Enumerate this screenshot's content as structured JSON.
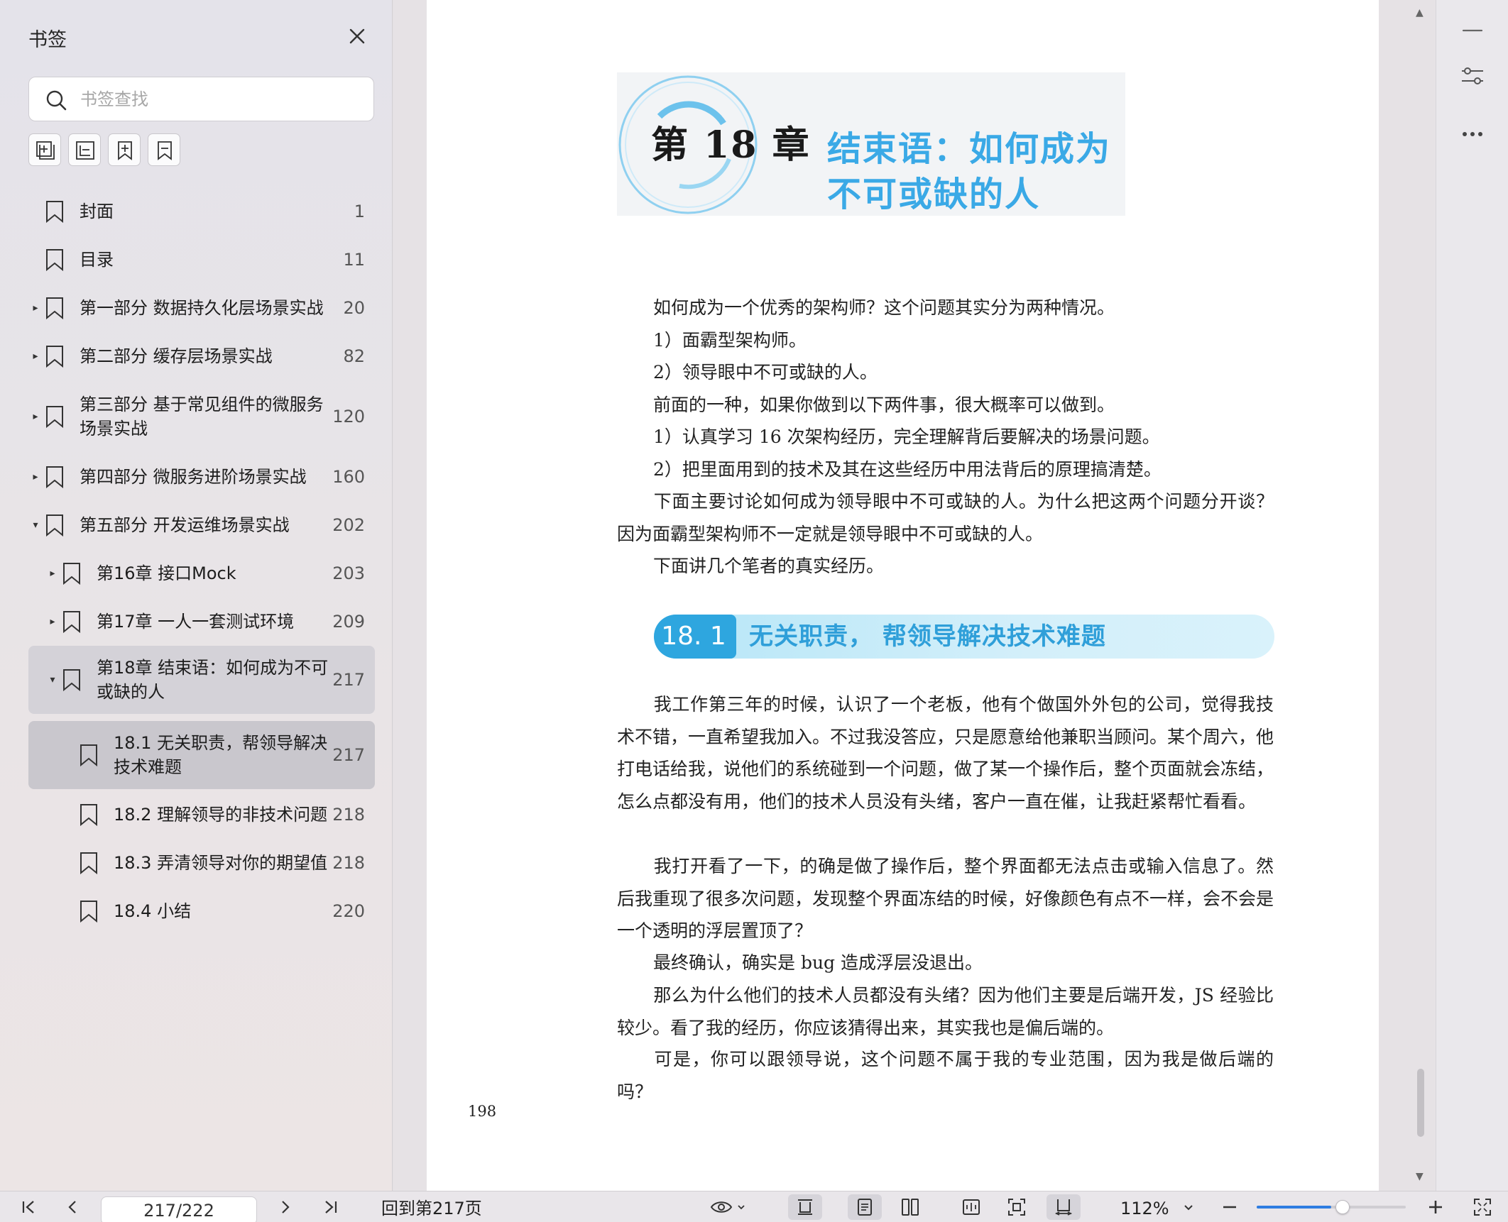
{
  "sidebar": {
    "title": "书签",
    "search_placeholder": "书签查找",
    "items": [
      {
        "label": "封面",
        "page": "1"
      },
      {
        "label": "目录",
        "page": "11"
      },
      {
        "label": "第一部分 数据持久化层场景实战",
        "page": "20"
      },
      {
        "label": "第二部分 缓存层场景实战",
        "page": "82"
      },
      {
        "label": "第三部分 基于常见组件的微服务",
        "label2": "场景实战",
        "page": "120"
      },
      {
        "label": "第四部分 微服务进阶场景实战",
        "page": "160"
      },
      {
        "label": "第五部分 开发运维场景实战",
        "page": "202"
      },
      {
        "label": "第16章 接口Mock",
        "page": "203"
      },
      {
        "label": "第17章 一人一套测试环境",
        "page": "209"
      },
      {
        "label": "第18章 结束语：如何成为不可",
        "label2": "或缺的人",
        "page": "217"
      },
      {
        "label": "18.1 无关职责，帮领导解决",
        "label2": "技术难题",
        "page": "217"
      },
      {
        "label": "18.2 理解领导的非技术问题",
        "page": "218"
      },
      {
        "label": "18.3 弄清领导对你的期望值",
        "page": "218"
      },
      {
        "label": "18.4 小结",
        "page": "220"
      }
    ]
  },
  "document": {
    "chapter_number": "第 18 章",
    "chapter_title_line1": "结束语：如何成为",
    "chapter_title_line2": "不可或缺的人",
    "intro_paragraphs": [
      "如何成为一个优秀的架构师？这个问题其实分为两种情况。",
      "1）面霸型架构师。",
      "2）领导眼中不可或缺的人。",
      "前面的一种，如果你做到以下两件事，很大概率可以做到。",
      "1）认真学习 16 次架构经历，完全理解背后要解决的场景问题。",
      "2）把里面用到的技术及其在这些经历中用法背后的原理搞清楚。",
      "下面主要讨论如何成为领导眼中不可或缺的人。为什么把这两个问题分开谈？因为面霸型架构师不一定就是领导眼中不可或缺的人。",
      "下面讲几个笔者的真实经历。"
    ],
    "section_number": "18. 1",
    "section_title": "无关职责， 帮领导解决技术难题",
    "body_paragraphs": [
      "我工作第三年的时候，认识了一个老板，他有个做国外外包的公司，觉得我技术不错，一直希望我加入。不过我没答应，只是愿意给他兼职当顾问。某个周六，他打电话给我，说他们的系统碰到一个问题，做了某一个操作后，整个页面就会冻结，怎么点都没有用，他们的技术人员没有头绪，客户一直在催，让我赶紧帮忙看看。",
      "我打开看了一下，的确是做了操作后，整个界面都无法点击或输入信息了。然后我重现了很多次问题，发现整个界面冻结的时候，好像颜色有点不一样，会不会是一个透明的浮层置顶了？",
      "最终确认，确实是 bug 造成浮层没退出。",
      "那么为什么他们的技术人员都没有头绪？因为他们主要是后端开发，JS 经验比较少。看了我的经历，你应该猜得出来，其实我也是偏后端的。",
      "可是，你可以跟领导说，这个问题不属于我的专业范围，因为我是做后端的吗？"
    ],
    "page_number": "198"
  },
  "bottom_bar": {
    "page_indicator": "217/222",
    "goto_label": "回到第217页",
    "zoom": "112%",
    "zoom_fraction": 0.5
  },
  "colors": {
    "accent_blue": "#2ea6df",
    "chapter_title": "#3aa9e6",
    "slider_blue": "#2f7de1"
  }
}
